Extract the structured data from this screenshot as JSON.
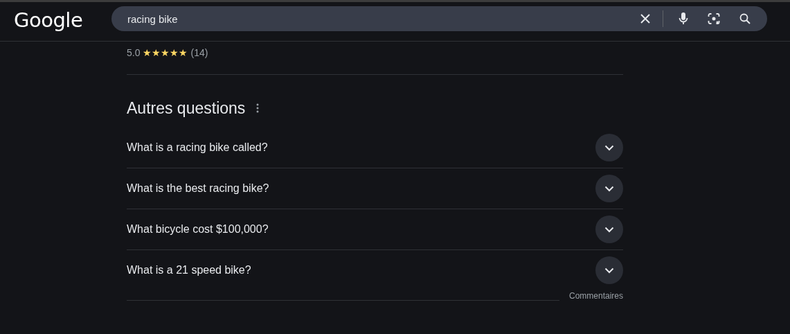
{
  "header": {
    "logo": "Google",
    "search": {
      "value": "racing bike"
    }
  },
  "rating": {
    "score": "5.0",
    "stars": 5,
    "count": "(14)"
  },
  "questions": {
    "title": "Autres questions",
    "items": [
      {
        "text": "What is a racing bike called?",
        "expanded": false
      },
      {
        "text": "What is the best racing bike?",
        "expanded": false
      },
      {
        "text": "What bicycle cost $100,000?",
        "expanded": false
      },
      {
        "text": "What is a 21 speed bike?",
        "expanded": false
      }
    ],
    "feedback": "Commentaires"
  }
}
